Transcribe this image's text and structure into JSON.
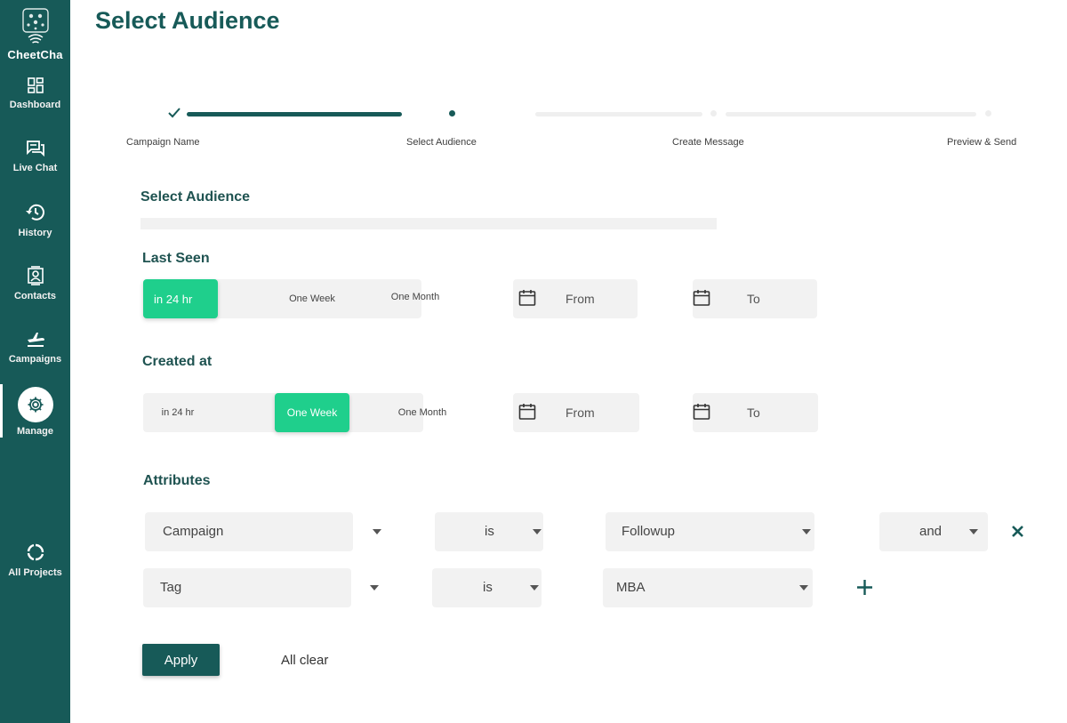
{
  "app": {
    "name": "CheetCha"
  },
  "sidebar": {
    "items": [
      {
        "label": "Dashboard",
        "icon": "dashboard-icon"
      },
      {
        "label": "Live Chat",
        "icon": "chat-icon"
      },
      {
        "label": "History",
        "icon": "history-icon"
      },
      {
        "label": "Contacts",
        "icon": "contacts-icon"
      },
      {
        "label": "Campaigns",
        "icon": "campaigns-icon"
      },
      {
        "label": "Manage",
        "icon": "gear-icon",
        "active": true
      },
      {
        "label": "All Projects",
        "icon": "refresh-icon"
      }
    ]
  },
  "page": {
    "title": "Select Audience"
  },
  "stepper": {
    "steps": [
      {
        "label": "Campaign  Name",
        "state": "done"
      },
      {
        "label": "Select Audience",
        "state": "current"
      },
      {
        "label": "Create Message",
        "state": "pending"
      },
      {
        "label": "Preview & Send",
        "state": "pending"
      }
    ]
  },
  "audience": {
    "title": "Select Audience"
  },
  "last_seen": {
    "title": "Last Seen",
    "options": [
      "in 24 hr",
      "One Week",
      "One Month"
    ],
    "selected": "in 24 hr",
    "from_placeholder": "From",
    "to_placeholder": "To"
  },
  "created_at": {
    "title": "Created at",
    "options": [
      "in 24 hr",
      "One Week",
      "One Month"
    ],
    "selected": "One Week",
    "from_placeholder": "From",
    "to_placeholder": "To"
  },
  "attributes": {
    "title": "Attributes",
    "rows": [
      {
        "field": "Campaign",
        "operator": "is",
        "value": "Followup",
        "conjunction": "and"
      },
      {
        "field": "Tag",
        "operator": "is",
        "value": "MBA"
      }
    ]
  },
  "actions": {
    "apply_label": "Apply",
    "clear_label": "All clear"
  },
  "colors": {
    "primary": "#175a58",
    "accent": "#1fcf8c",
    "field_bg": "#f2f2f2"
  }
}
